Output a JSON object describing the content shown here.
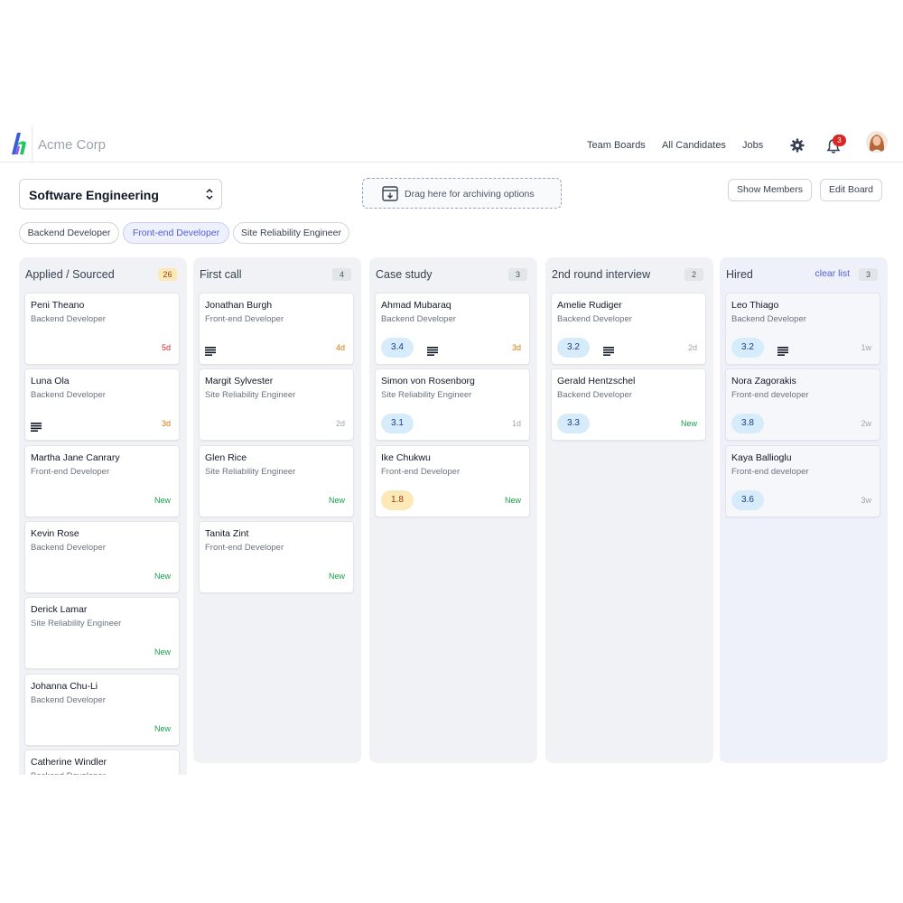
{
  "app": {
    "company": "Acme Corp",
    "nav": [
      "Team Boards",
      "All Candidates",
      "Jobs"
    ],
    "notification_count": "3",
    "brand_colors": {
      "logo_blue": "#3b5bdb",
      "logo_green": "#22c55e",
      "logo_purple": "#8b5cf6",
      "accent": "#4f5fd5"
    }
  },
  "board": {
    "selected": "Software Engineering",
    "archive_hint": "Drag here for archiving options",
    "show_members": "Show Members",
    "edit_board": "Edit Board",
    "filters": [
      {
        "label": "Backend Developer",
        "active": false
      },
      {
        "label": "Front-end Developer",
        "active": true
      },
      {
        "label": "Site Reliability Engineer",
        "active": false
      }
    ]
  },
  "columns": [
    {
      "title": "Applied / Sourced",
      "count": "26",
      "cards": [
        {
          "name": "Peni Theano",
          "role": "Backend Developer",
          "age": "5d",
          "age_color": "red",
          "notes": false
        },
        {
          "name": "Luna Ola",
          "role": "Backend Developer",
          "age": "3d",
          "age_color": "orange",
          "notes": true
        },
        {
          "name": "Martha Jane Canrary",
          "role": "Front-end Developer",
          "age": "New",
          "age_color": "new",
          "notes": false
        },
        {
          "name": "Kevin Rose",
          "role": "Backend Developer",
          "age": "New",
          "age_color": "new",
          "notes": false
        },
        {
          "name": "Derick Lamar",
          "role": "Site Reliability Engineer",
          "age": "New",
          "age_color": "new",
          "notes": false
        },
        {
          "name": "Johanna Chu-Li",
          "role": "Backend Developer",
          "age": "New",
          "age_color": "new",
          "notes": false
        },
        {
          "name": "Catherine Windler",
          "role": "Backend Developer",
          "age": "",
          "age_color": "new",
          "notes": false
        }
      ]
    },
    {
      "title": "First call",
      "count": "4",
      "cards": [
        {
          "name": "Jonathan Burgh",
          "role": "Front-end Developer",
          "age": "4d",
          "age_color": "orange",
          "notes": true
        },
        {
          "name": "Margit Sylvester",
          "role": "Site Reliability Engineer",
          "age": "2d",
          "age_color": "grey",
          "notes": false
        },
        {
          "name": "Glen Rice",
          "role": "Site Reliability Engineer",
          "age": "New",
          "age_color": "new",
          "notes": false
        },
        {
          "name": "Tanita Zint",
          "role": "Front-end Developer",
          "age": "New",
          "age_color": "new",
          "notes": false
        }
      ]
    },
    {
      "title": "Case study",
      "count": "3",
      "cards": [
        {
          "name": "Ahmad Mubaraq",
          "role": "Backend Developer",
          "age": "3d",
          "age_color": "orange",
          "notes": true,
          "score": "3.4"
        },
        {
          "name": "Simon von Rosenborg",
          "role": "Site Reliability Engineer",
          "age": "1d",
          "age_color": "grey",
          "notes": false,
          "score": "3.1"
        },
        {
          "name": "Ike Chukwu",
          "role": "Front-end Developer",
          "age": "New",
          "age_color": "new",
          "notes": false,
          "score": "1.8",
          "score_low": true
        }
      ]
    },
    {
      "title": "2nd round interview",
      "count": "2",
      "cards": [
        {
          "name": "Amelie Rudiger",
          "role": "Backend Developer",
          "age": "2d",
          "age_color": "grey",
          "notes": true,
          "score": "3.2"
        },
        {
          "name": "Gerald Hentzschel",
          "role": "Backend Developer",
          "age": "New",
          "age_color": "new",
          "notes": false,
          "score": "3.3"
        }
      ]
    },
    {
      "title": "Hired",
      "count": "3",
      "clear_label": "clear list",
      "cards": [
        {
          "name": "Leo Thiago",
          "role": "Backend Developer",
          "age": "1w",
          "age_color": "grey",
          "notes": true,
          "score": "3.2"
        },
        {
          "name": "Nora Zagorakis",
          "role": "Front-end developer",
          "age": "2w",
          "age_color": "grey",
          "notes": false,
          "score": "3.8"
        },
        {
          "name": "Kaya Ballioglu",
          "role": "Front-end developer",
          "age": "3w",
          "age_color": "grey",
          "notes": false,
          "score": "3.6"
        }
      ]
    }
  ]
}
